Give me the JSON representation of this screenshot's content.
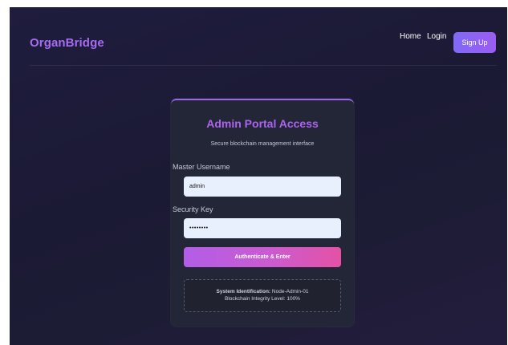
{
  "header": {
    "brand": "OrganBridge",
    "nav": {
      "home": "Home",
      "login": "Login",
      "signup": "Sign Up"
    }
  },
  "card": {
    "title": "Admin Portal Access",
    "subtitle": "Secure blockchain management interface",
    "username": {
      "label": "Master Username",
      "value": "admin"
    },
    "security_key": {
      "label": "Security Key",
      "value": "••••••••"
    },
    "submit_label": "Authenticate & Enter",
    "system_info": {
      "id_label": "System Identification:",
      "id_value": "Node-Admin-01",
      "integrity": "Blockchain Integrity Level: 100%"
    }
  },
  "colors": {
    "brand": "#a76cf2",
    "title": "#ae63ee",
    "accent_start": "#b25de8",
    "accent_end": "#e452a5",
    "background": "#1f1c3e",
    "card": "#222637"
  }
}
